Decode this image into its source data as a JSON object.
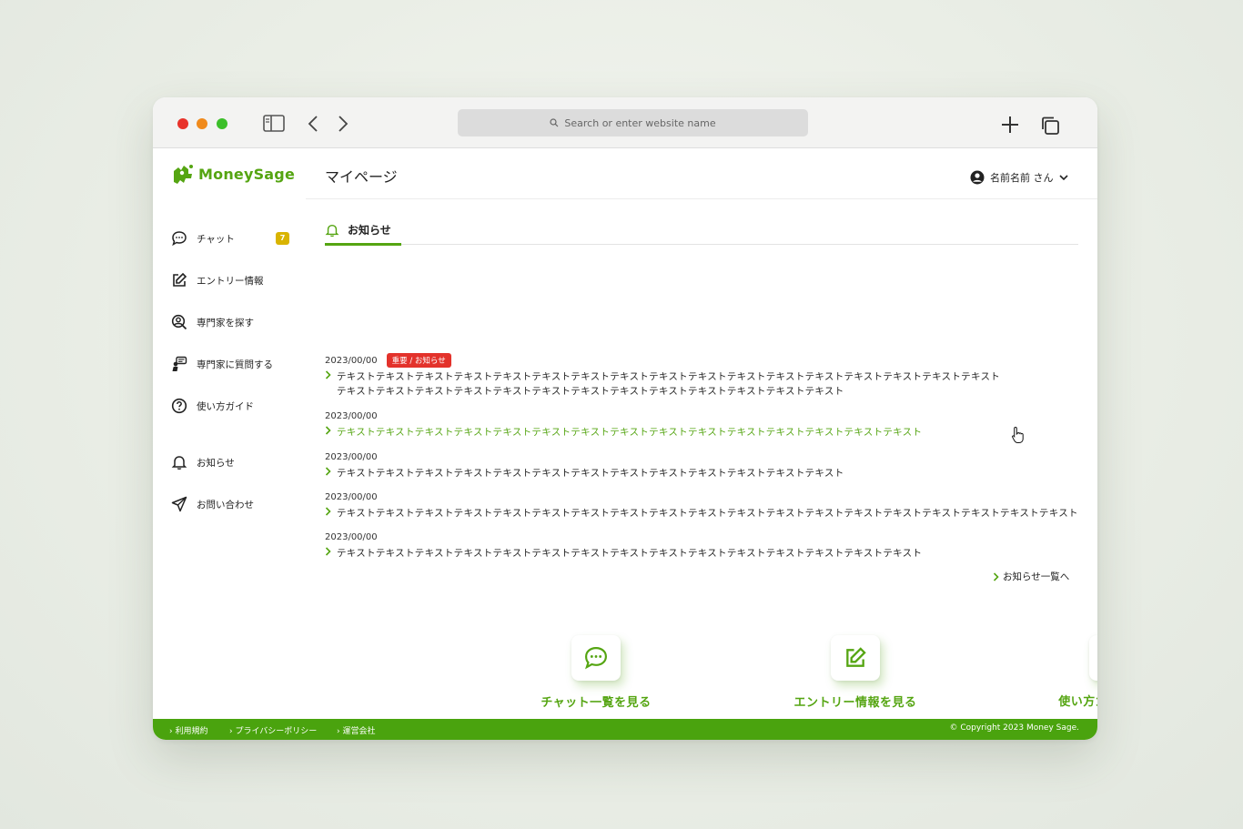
{
  "browser": {
    "address_placeholder": "Search or enter website name"
  },
  "brand": {
    "name": "MoneySage",
    "accent": "#55a512",
    "footer_green": "#4aa30e",
    "alert_red": "#e3322b",
    "badge_yellow": "#d9b400"
  },
  "sidebar": {
    "items": [
      {
        "label": "チャット",
        "icon": "chat-bubble-icon",
        "badge": "7"
      },
      {
        "label": "エントリー情報",
        "icon": "edit-icon"
      },
      {
        "label": "専門家を探す",
        "icon": "user-search-icon"
      },
      {
        "label": "専門家に質問する",
        "icon": "ask-expert-icon"
      },
      {
        "label": "使い方ガイド",
        "icon": "question-circle-icon"
      },
      {
        "label": "お知らせ",
        "icon": "bell-icon"
      },
      {
        "label": "お問い合わせ",
        "icon": "paper-plane-icon"
      }
    ]
  },
  "header": {
    "title": "マイページ",
    "user_name": "名前名前 さん"
  },
  "notices": {
    "tab_label": "お知らせ",
    "items": [
      {
        "date": "2023/00/00",
        "tag": "重要 / お知らせ",
        "line1": "テキストテキストテキストテキストテキストテキストテキストテキストテキストテキストテキストテキストテキストテキストテキストテキストテキスト",
        "line2": "テキストテキストテキストテキストテキストテキストテキストテキストテキストテキストテキストテキストテキスト"
      },
      {
        "date": "2023/00/00",
        "line1": "テキストテキストテキストテキストテキストテキストテキストテキストテキストテキストテキストテキストテキストテキストテキスト"
      },
      {
        "date": "2023/00/00",
        "line1": "テキストテキストテキストテキストテキストテキストテキストテキストテキストテキストテキストテキストテキスト"
      },
      {
        "date": "2023/00/00",
        "line1": "テキストテキストテキストテキストテキストテキストテキストテキストテキストテキストテキストテキストテキストテキストテキストテキストテキストテキストテキスト"
      },
      {
        "date": "2023/00/00",
        "line1": "テキストテキストテキストテキストテキストテキストテキストテキストテキストテキストテキストテキストテキストテキストテキスト"
      }
    ],
    "more_label": "お知らせ一覧へ"
  },
  "quick_links": [
    {
      "label": "チャット一覧を見る",
      "icon": "chat-bubble-icon"
    },
    {
      "label": "エントリー情報を見る",
      "icon": "edit-icon"
    },
    {
      "label": "使い方ガイドを見る",
      "icon": "question-circle-icon"
    }
  ],
  "footer": {
    "links": [
      "利用規約",
      "プライバシーポリシー",
      "運営会社"
    ],
    "copyright": "© Copyright 2023 Money Sage."
  }
}
